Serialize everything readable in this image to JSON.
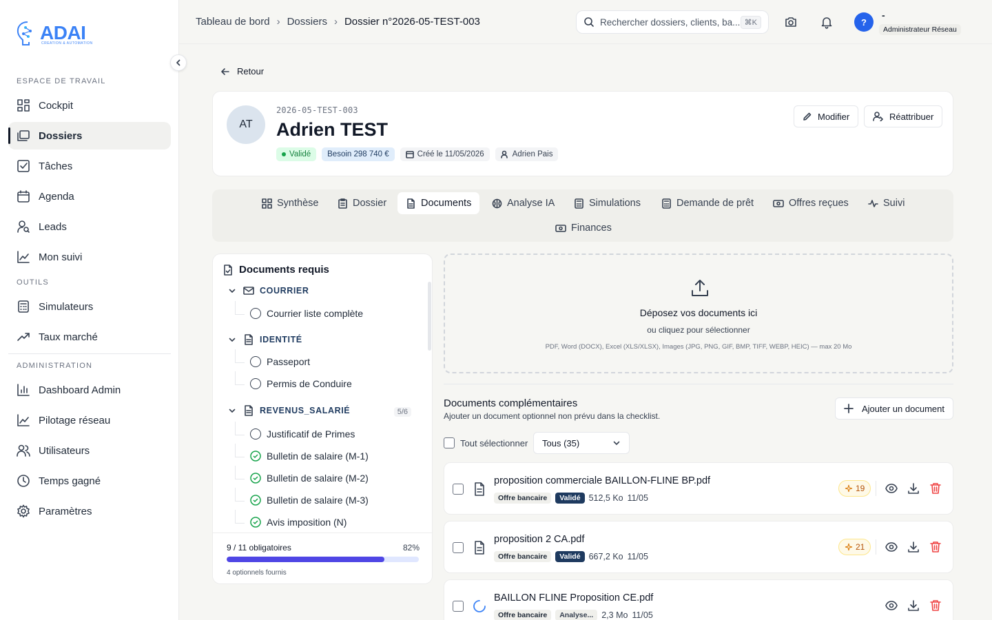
{
  "brand": {
    "logo_text": "ADAI",
    "logo_sub": "CREATION & AUTOMATION",
    "accent": "#3b82f6"
  },
  "sidebar": {
    "sections": {
      "workspace": "ESPACE DE TRAVAIL",
      "tools": "OUTILS",
      "admin": "ADMINISTRATION"
    },
    "items": [
      {
        "label": "Cockpit",
        "icon": "grid-icon"
      },
      {
        "label": "Dossiers",
        "icon": "folders-icon",
        "active": true
      },
      {
        "label": "Tâches",
        "icon": "checkbox-icon"
      },
      {
        "label": "Agenda",
        "icon": "calendar-icon"
      },
      {
        "label": "Leads",
        "icon": "user-search-icon"
      },
      {
        "label": "Mon suivi",
        "icon": "line-chart-icon"
      },
      {
        "label": "Simulateurs",
        "icon": "calculator-icon"
      },
      {
        "label": "Taux marché",
        "icon": "trending-up-icon"
      },
      {
        "label": "Dashboard Admin",
        "icon": "bar-chart-icon"
      },
      {
        "label": "Pilotage réseau",
        "icon": "line-chart-icon"
      },
      {
        "label": "Utilisateurs",
        "icon": "users-icon"
      },
      {
        "label": "Temps gagné",
        "icon": "clock-icon"
      },
      {
        "label": "Paramètres",
        "icon": "gear-icon"
      }
    ]
  },
  "header": {
    "breadcrumb": [
      "Tableau de bord",
      "Dossiers",
      "Dossier n°2026-05-TEST-003"
    ],
    "search_placeholder": "Rechercher dossiers, clients, ba...",
    "search_shortcut": "⌘K",
    "user_initial": "?",
    "user_name": "-",
    "user_role": "Administrateur Réseau"
  },
  "back_label": "Retour",
  "profile": {
    "initials": "AT",
    "reference": "2026-05-TEST-003",
    "name": "Adrien TEST",
    "status": "Validé",
    "need": "Besoin 298 740 €",
    "created": "Créé le 11/05/2026",
    "advisor": "Adrien Pais",
    "edit_label": "Modifier",
    "reassign_label": "Réattribuer"
  },
  "tabs": [
    {
      "label": "Synthèse"
    },
    {
      "label": "Dossier"
    },
    {
      "label": "Documents",
      "active": true
    },
    {
      "label": "Analyse IA"
    },
    {
      "label": "Simulations"
    },
    {
      "label": "Demande de prêt"
    },
    {
      "label": "Offres reçues"
    },
    {
      "label": "Suivi"
    },
    {
      "label": "Finances"
    }
  ],
  "required": {
    "title": "Documents requis",
    "groups": [
      {
        "name": "COURRIER",
        "items": [
          {
            "label": "Courrier liste complète",
            "done": false
          }
        ]
      },
      {
        "name": "IDENTITÉ",
        "items": [
          {
            "label": "Passeport",
            "done": false
          },
          {
            "label": "Permis de Conduire",
            "done": false
          }
        ]
      },
      {
        "name": "REVENUS_SALARIÉ",
        "count": "5/6",
        "items": [
          {
            "label": "Justificatif de Primes",
            "done": false
          },
          {
            "label": "Bulletin de salaire (M-1)",
            "done": true
          },
          {
            "label": "Bulletin de salaire (M-2)",
            "done": true
          },
          {
            "label": "Bulletin de salaire (M-3)",
            "done": true
          },
          {
            "label": "Avis imposition (N)",
            "done": true
          }
        ]
      }
    ],
    "progress_label": "9 / 11 obligatoires",
    "progress_pct_label": "82%",
    "progress_value": 0.82,
    "optional_label": "4 optionnels fournis"
  },
  "dropzone": {
    "title": "Déposez vos documents ici",
    "subtitle": "ou cliquez pour sélectionner",
    "formats": "PDF, Word (DOCX), Excel (XLS/XLSX), Images (JPG, PNG, GIF, BMP, TIFF, WEBP, HEIC) — max 20 Mo"
  },
  "complementary": {
    "title": "Documents complémentaires",
    "subtitle": "Ajouter un document optionnel non prévu dans la checklist.",
    "add_label": "Ajouter un document",
    "select_all": "Tout sélectionner",
    "filter": "Tous (35)",
    "docs": [
      {
        "name": "proposition commerciale BAILLON-FLINE BP.pdf",
        "category": "Offre bancaire",
        "status": "Validé",
        "size": "512,5 Ko",
        "date": "11/05",
        "score": "19"
      },
      {
        "name": "proposition 2 CA.pdf",
        "category": "Offre bancaire",
        "status": "Validé",
        "size": "667,2 Ko",
        "date": "11/05",
        "score": "21"
      },
      {
        "name": "BAILLON FLINE Proposition CE.pdf",
        "category": "Offre bancaire",
        "status": "Analyse...",
        "size": "2,3 Mo",
        "date": "11/05"
      }
    ]
  }
}
